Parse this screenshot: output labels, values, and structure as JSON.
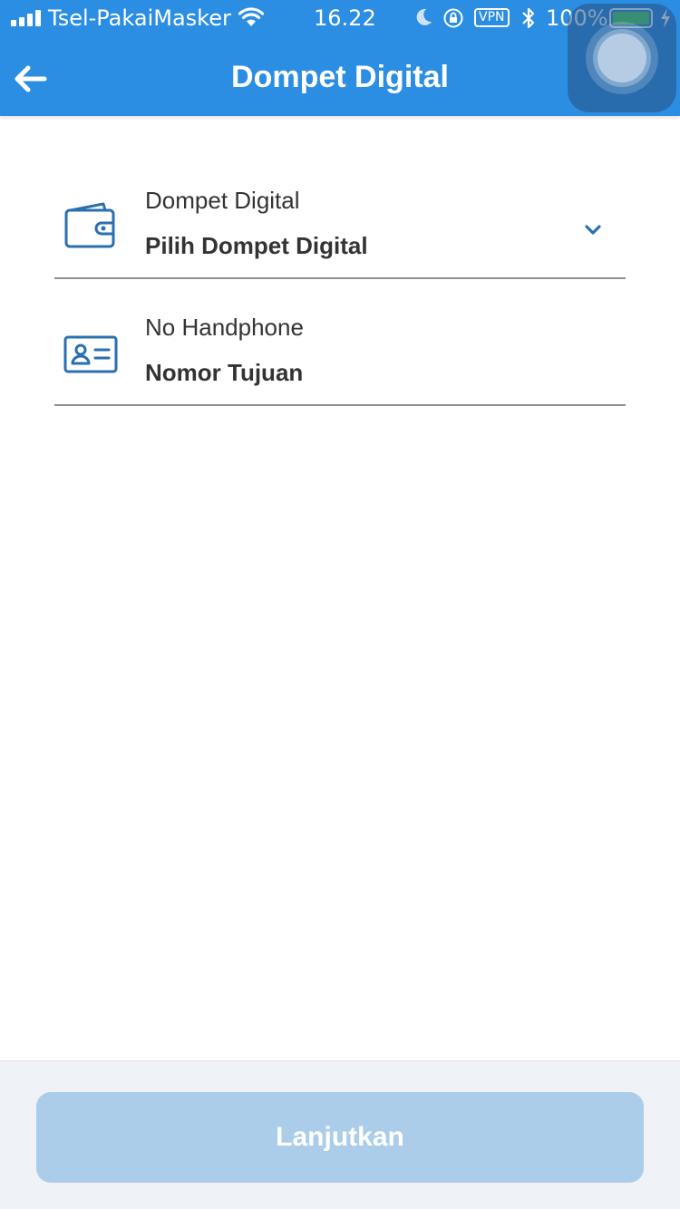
{
  "status_bar": {
    "carrier": "Tsel-PakaiMasker",
    "time": "16.22",
    "vpn": "VPN",
    "battery": "100%",
    "battery_level": 1.0
  },
  "header": {
    "title": "Dompet Digital",
    "color": "#2b8ee3"
  },
  "form": {
    "wallet": {
      "label": "Dompet Digital",
      "value": "Pilih Dompet Digital",
      "icon": "wallet-icon"
    },
    "phone": {
      "label": "No Handphone",
      "value": "Nomor Tujuan",
      "icon": "id-card-icon"
    },
    "icon_color": "#2a6fb0"
  },
  "footer": {
    "next_label": "Lanjutkan",
    "button_color": "#abcde9"
  }
}
